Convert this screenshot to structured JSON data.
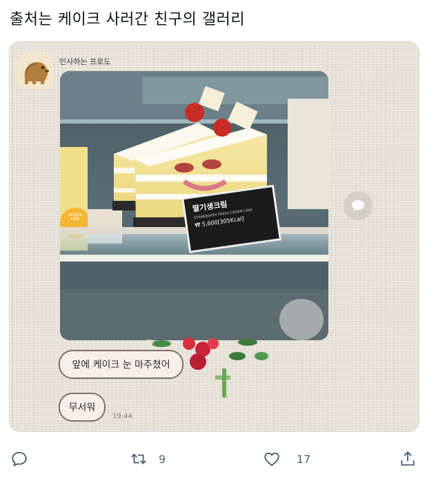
{
  "tweet": {
    "text": "출처는 케이크 사러간 친구의 갤러리"
  },
  "chat": {
    "sender_name": "인사하는 프로도",
    "messages": [
      {
        "text": "앞에 케이크 눈 마주쳤어"
      },
      {
        "text": "무서워"
      }
    ],
    "timestamp": "19:44"
  },
  "photo": {
    "price_card": {
      "title": "딸기생크림",
      "subtitle": "STRAWBERRY FRESH CREAM CAKE",
      "price": "₩ 5,600[305Kcal]"
    },
    "badge": "GLUTEN FREE"
  },
  "actions": {
    "retweet_count": "9",
    "like_count": "17"
  },
  "icons": [
    "reply-icon",
    "retweet-icon",
    "like-icon",
    "share-icon",
    "chat-share-icon"
  ]
}
